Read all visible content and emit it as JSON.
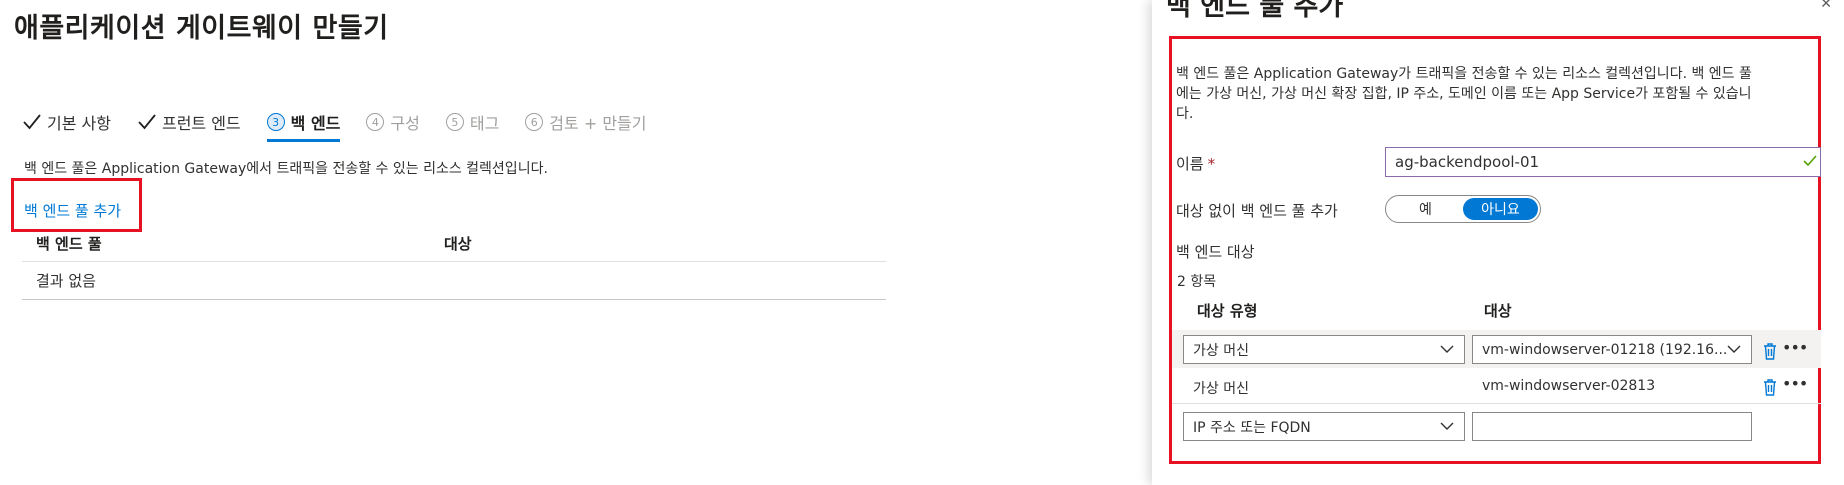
{
  "page": {
    "title": "애플리케이션 게이트웨이 만들기"
  },
  "tabs": [
    {
      "label": "기본 사항",
      "state": "done",
      "icon": "check-icon"
    },
    {
      "label": "프런트 엔드",
      "state": "done",
      "icon": "check-icon"
    },
    {
      "number": "3",
      "label": "백 엔드",
      "state": "active"
    },
    {
      "number": "4",
      "label": "구성",
      "state": "disabled"
    },
    {
      "number": "5",
      "label": "태그",
      "state": "disabled"
    },
    {
      "number": "6",
      "label": "검토 + 만들기",
      "state": "disabled"
    }
  ],
  "backend": {
    "description": "백 엔드 풀은 Application Gateway에서 트래픽을 전송할 수 있는 리소스 컬렉션입니다.",
    "add_pool_link": "백 엔드 풀 추가",
    "table": {
      "columns": [
        "백 엔드 풀",
        "대상"
      ],
      "empty_text": "결과 없음"
    }
  },
  "panel": {
    "header": "백 엔드 풀 추가",
    "close_icon": "close-icon",
    "description_lines": [
      "백 엔드 풀은 Application Gateway가 트래픽을 전송할 수 있는 리소스 컬렉션입니다. 백 엔드 풀",
      "에는 가상 머신, 가상 머신 확장 집합, IP 주소, 도메인 이름 또는 App Service가 포함될 수 있습니",
      "다."
    ],
    "name_label": "이름",
    "name_required": "*",
    "name_value": "ag-backendpool-01",
    "no_targets_label": "대상 없이 백 엔드 풀 추가",
    "toggle": {
      "yes": "예",
      "no": "아니요",
      "selected": "아니요"
    },
    "targets_title": "백 엔드 대상",
    "items_count": "2 항목",
    "target_columns": [
      "대상 유형",
      "대상"
    ],
    "targets": [
      {
        "type": "가상 머신",
        "target": "vm-windowserver-01218 (192.16...",
        "editable": true
      },
      {
        "type": "가상 머신",
        "target": "vm-windowserver-02813",
        "editable": false
      },
      {
        "type": "IP 주소 또는 FQDN",
        "target": "",
        "editable": true
      }
    ],
    "colors": {
      "accent": "#0078d4",
      "highlight": "#e81123",
      "valid": "#57a300"
    }
  }
}
